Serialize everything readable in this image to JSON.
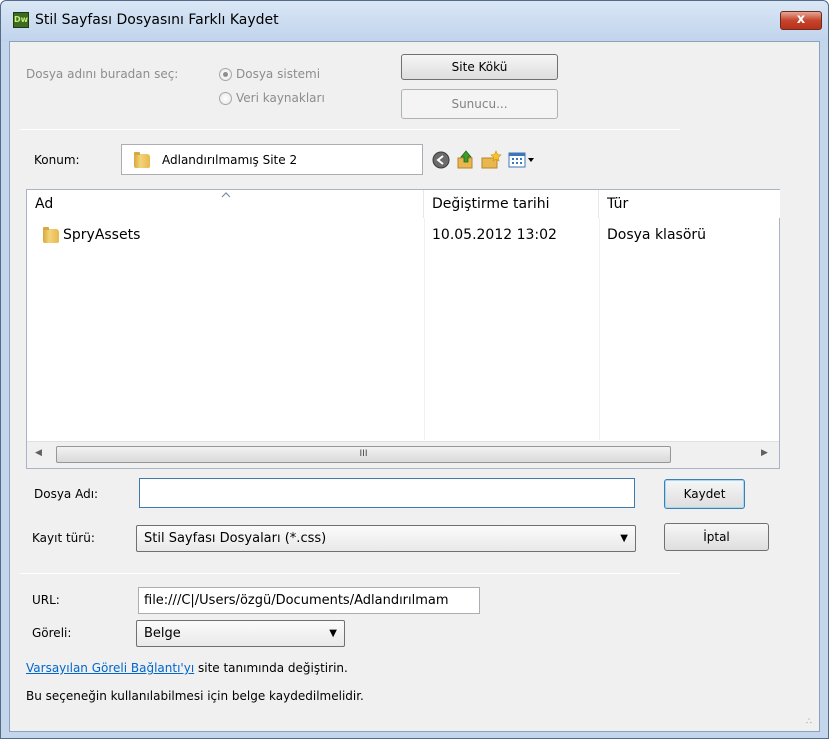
{
  "window": {
    "title": "Stil Sayfası Dosyasını Farklı Kaydet",
    "app_icon": "Dw",
    "close_glyph": "x"
  },
  "source": {
    "label": "Dosya adını buradan seç:",
    "option_filesystem": "Dosya sistemi",
    "option_datasources": "Veri kaynakları",
    "site_root_button": "Site Kökü",
    "server_button": "Sunucu..."
  },
  "location": {
    "label": "Konum:",
    "value": "Adlandırılmamış Site 2",
    "tools": [
      "back-icon",
      "up-folder-icon",
      "new-folder-icon",
      "view-menu-icon"
    ]
  },
  "file_list": {
    "columns": [
      "Ad",
      "Değiştirme tarihi",
      "Tür"
    ],
    "rows": [
      {
        "name": "SpryAssets",
        "modified": "10.05.2012 13:02",
        "type": "Dosya klasörü"
      }
    ],
    "scroll_thumb": "III"
  },
  "filename": {
    "label": "Dosya Adı:",
    "value": ""
  },
  "filetype": {
    "label": "Kayıt türü:",
    "selected": "Stil Sayfası Dosyaları (*.css)"
  },
  "buttons": {
    "save": "Kaydet",
    "cancel": "İptal"
  },
  "url": {
    "label": "URL:",
    "value": "file:///C|/Users/özgü/Documents/Adlandırılmam"
  },
  "relative": {
    "label": "Göreli:",
    "selected": "Belge"
  },
  "footer": {
    "link_text": "Varsayılan Göreli Bağlantı'yı",
    "link_suffix": " site tanımında değiştirin.",
    "note": "Bu seçeneğin kullanılabilmesi için belge kaydedilmelidir."
  },
  "colors": {
    "link": "#0066cc",
    "close_button": "#c5442b",
    "folder": "#e8b84f"
  }
}
